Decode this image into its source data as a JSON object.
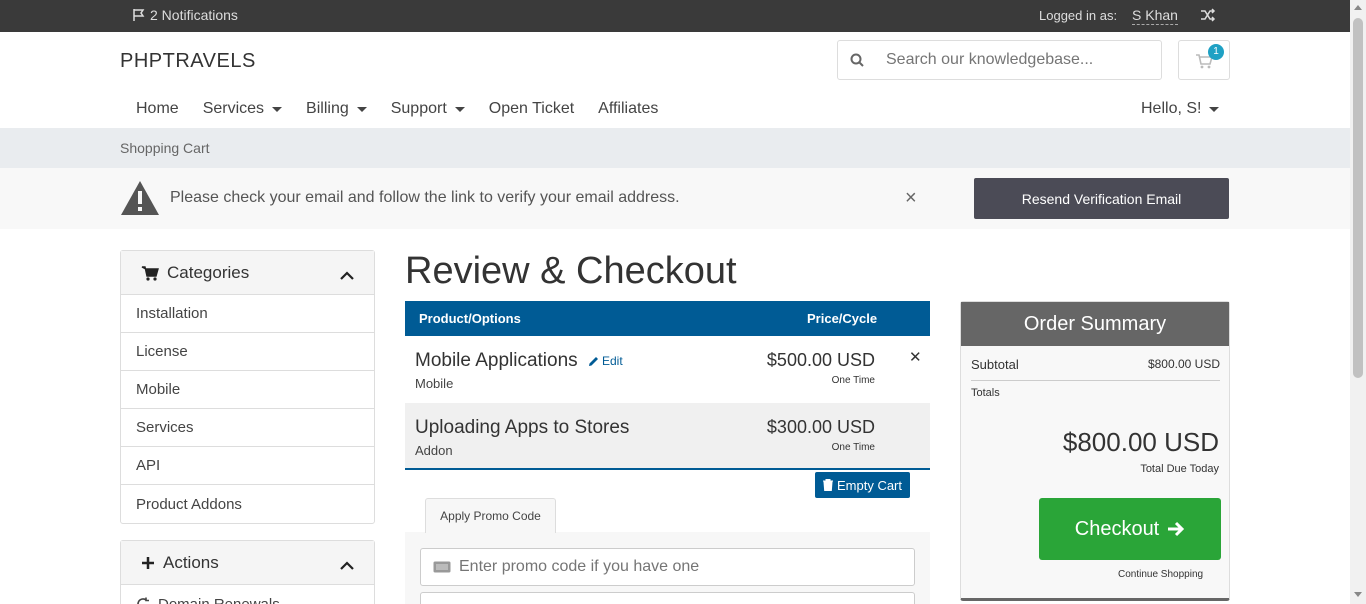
{
  "topbar": {
    "notifications": "2 Notifications",
    "logged_in_label": "Logged in as:",
    "user_name": "S Khan"
  },
  "header": {
    "logo": "PHPTRAVELS",
    "search_placeholder": "Search our knowledgebase...",
    "cart_count": "1"
  },
  "nav": {
    "home": "Home",
    "services": "Services",
    "billing": "Billing",
    "support": "Support",
    "open_ticket": "Open Ticket",
    "affiliates": "Affiliates",
    "hello": "Hello, S!"
  },
  "breadcrumb": "Shopping Cart",
  "alert": {
    "message": "Please check your email and follow the link to verify your email address.",
    "close": "×",
    "resend_label": "Resend Verification Email"
  },
  "sidebar": {
    "categories_title": "Categories",
    "categories": [
      "Installation",
      "License",
      "Mobile",
      "Services",
      "API",
      "Product Addons"
    ],
    "actions_title": "Actions",
    "actions": [
      "Domain Renewals"
    ]
  },
  "main": {
    "title": "Review & Checkout",
    "col_product": "Product/Options",
    "col_price": "Price/Cycle",
    "items": [
      {
        "name": "Mobile Applications",
        "group": "Mobile",
        "price": "$500.00 USD",
        "cycle": "One Time",
        "edit": "Edit"
      },
      {
        "name": "Uploading Apps to Stores",
        "group": "Addon",
        "price": "$300.00 USD",
        "cycle": "One Time"
      }
    ],
    "empty_cart": "Empty Cart",
    "promo_tab": "Apply Promo Code",
    "promo_placeholder": "Enter promo code if you have one"
  },
  "summary": {
    "title": "Order Summary",
    "subtotal_label": "Subtotal",
    "subtotal_value": "$800.00 USD",
    "totals_label": "Totals",
    "total": "$800.00 USD",
    "due_label": "Total Due Today",
    "checkout_label": "Checkout",
    "continue_label": "Continue Shopping"
  },
  "colors": {
    "primary": "#005b95",
    "success": "#2aa538",
    "topbar": "#3a3a3a",
    "badge": "#1fa1c4"
  }
}
